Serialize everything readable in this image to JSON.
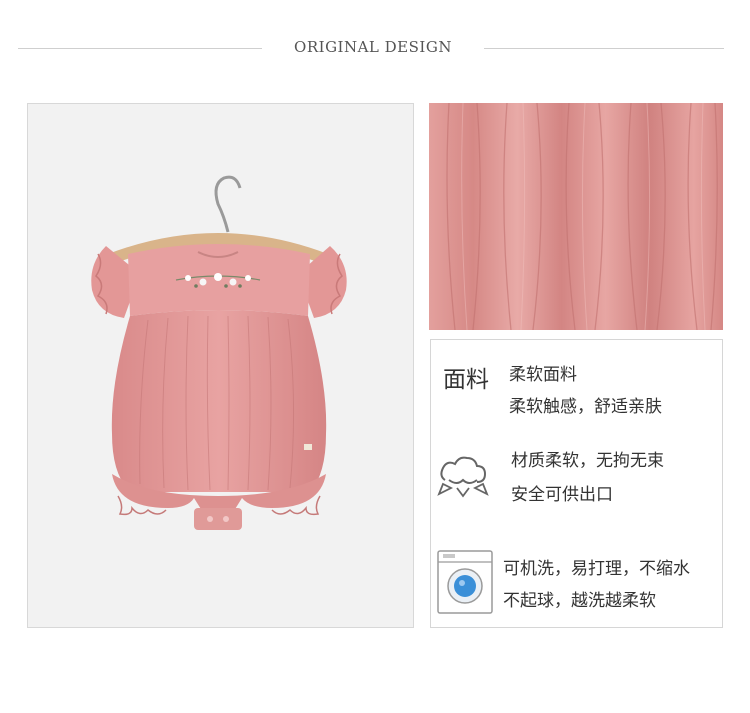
{
  "header": {
    "title": "ORIGINAL DESIGN"
  },
  "fabric": {
    "label": "面料",
    "line1": "柔软面料",
    "line2": "柔软触感，舒适亲肤"
  },
  "material": {
    "icon": "cotton-cloud-icon",
    "line1": "材质柔软，无拘无束",
    "line2": "安全可供出口"
  },
  "washing": {
    "icon": "washing-machine-icon",
    "line1": "可机洗，易打理，不缩水",
    "line2": "不起球，越洗越柔软"
  },
  "colors": {
    "fabric_pink": "#e49d9a",
    "fabric_shadow": "#cf7f7d"
  }
}
